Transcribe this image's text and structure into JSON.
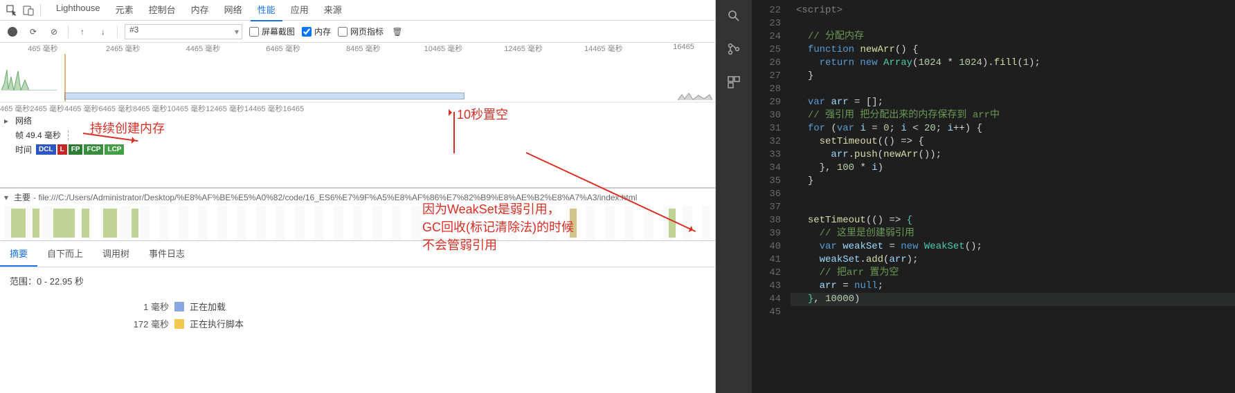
{
  "devtools": {
    "header_tabs": [
      "Lighthouse",
      "元素",
      "控制台",
      "内存",
      "网络",
      "性能",
      "应用",
      "来源"
    ],
    "active_header_tab": 5,
    "toolbar": {
      "session_select": "#3",
      "chk_screenshot": "屏幕截图",
      "chk_memory": "内存",
      "chk_webvitals": "网页指标"
    },
    "ruler_ticks": [
      "465 毫秒",
      "2465 毫秒",
      "4465 毫秒",
      "6465 毫秒",
      "8465 毫秒",
      "10465 毫秒",
      "12465 毫秒",
      "14465 毫秒",
      "16465"
    ],
    "rows": {
      "network": "网络",
      "frame": "帧 49.4 毫秒",
      "time": "时间"
    },
    "badges": [
      "DCL",
      "L",
      "FP",
      "FCP",
      "LCP"
    ],
    "main_label": "主要",
    "main_path": "- file:///C:/Users/Administrator/Desktop/%E8%AF%BE%E5%A0%82/code/16_ES6%E7%9F%A5%E8%AF%86%E7%82%B9%E8%AE%B2%E8%A7%A3/index.html",
    "bottom_tabs": [
      "摘要",
      "自下而上",
      "调用树",
      "事件日志"
    ],
    "summary_range": "范围：0 - 22.95 秒",
    "legend": [
      {
        "dur": "1 毫秒",
        "label": "正在加载",
        "class": "sw-load"
      },
      {
        "dur": "172 毫秒",
        "label": "正在执行脚本",
        "class": "sw-script"
      }
    ]
  },
  "annotations": {
    "a1": "持续创建内存",
    "a2": "10秒置空",
    "a3_l1": "因为WeakSet是弱引用，",
    "a3_l2": "GC回收(标记清除法)的时候",
    "a3_l3": "不会管弱引用"
  },
  "editor": {
    "first_line": 22,
    "highlight_line": 44,
    "lines": [
      {
        "n": 22,
        "seg": [
          {
            "c": "t-tag",
            "t": "<script>"
          }
        ]
      },
      {
        "n": 23,
        "seg": [
          {
            "c": "",
            "t": ""
          }
        ]
      },
      {
        "n": 24,
        "seg": [
          {
            "c": "",
            "t": "  "
          },
          {
            "c": "t-cm",
            "t": "// 分配内存"
          }
        ]
      },
      {
        "n": 25,
        "seg": [
          {
            "c": "",
            "t": "  "
          },
          {
            "c": "t-kw",
            "t": "function"
          },
          {
            "c": "",
            "t": " "
          },
          {
            "c": "t-fn",
            "t": "newArr"
          },
          {
            "c": "t-op",
            "t": "() {"
          }
        ]
      },
      {
        "n": 26,
        "seg": [
          {
            "c": "",
            "t": "    "
          },
          {
            "c": "t-kw",
            "t": "return new"
          },
          {
            "c": "",
            "t": " "
          },
          {
            "c": "t-type",
            "t": "Array"
          },
          {
            "c": "t-op",
            "t": "("
          },
          {
            "c": "t-num",
            "t": "1024"
          },
          {
            "c": "t-op",
            "t": " * "
          },
          {
            "c": "t-num",
            "t": "1024"
          },
          {
            "c": "t-op",
            "t": ")."
          },
          {
            "c": "t-fn",
            "t": "fill"
          },
          {
            "c": "t-op",
            "t": "("
          },
          {
            "c": "t-num",
            "t": "1"
          },
          {
            "c": "t-op",
            "t": ");"
          }
        ]
      },
      {
        "n": 27,
        "seg": [
          {
            "c": "",
            "t": "  "
          },
          {
            "c": "t-op",
            "t": "}"
          }
        ]
      },
      {
        "n": 28,
        "seg": [
          {
            "c": "",
            "t": ""
          }
        ]
      },
      {
        "n": 29,
        "seg": [
          {
            "c": "",
            "t": "  "
          },
          {
            "c": "t-kw",
            "t": "var"
          },
          {
            "c": "",
            "t": " "
          },
          {
            "c": "t-var",
            "t": "arr"
          },
          {
            "c": "t-op",
            "t": " = [];"
          }
        ]
      },
      {
        "n": 30,
        "seg": [
          {
            "c": "",
            "t": "  "
          },
          {
            "c": "t-cm",
            "t": "// 强引用 把分配出来的内存保存到 arr中"
          }
        ]
      },
      {
        "n": 31,
        "seg": [
          {
            "c": "",
            "t": "  "
          },
          {
            "c": "t-kw",
            "t": "for"
          },
          {
            "c": "t-op",
            "t": " ("
          },
          {
            "c": "t-kw",
            "t": "var"
          },
          {
            "c": "",
            "t": " "
          },
          {
            "c": "t-var",
            "t": "i"
          },
          {
            "c": "t-op",
            "t": " = "
          },
          {
            "c": "t-num",
            "t": "0"
          },
          {
            "c": "t-op",
            "t": "; "
          },
          {
            "c": "t-var",
            "t": "i"
          },
          {
            "c": "t-op",
            "t": " < "
          },
          {
            "c": "t-num",
            "t": "20"
          },
          {
            "c": "t-op",
            "t": "; "
          },
          {
            "c": "t-var",
            "t": "i"
          },
          {
            "c": "t-op",
            "t": "++) {"
          }
        ]
      },
      {
        "n": 32,
        "seg": [
          {
            "c": "",
            "t": "    "
          },
          {
            "c": "t-fn",
            "t": "setTimeout"
          },
          {
            "c": "t-op",
            "t": "(() => {"
          }
        ]
      },
      {
        "n": 33,
        "seg": [
          {
            "c": "",
            "t": "      "
          },
          {
            "c": "t-var",
            "t": "arr"
          },
          {
            "c": "t-op",
            "t": "."
          },
          {
            "c": "t-fn",
            "t": "push"
          },
          {
            "c": "t-op",
            "t": "("
          },
          {
            "c": "t-fn",
            "t": "newArr"
          },
          {
            "c": "t-op",
            "t": "());"
          }
        ]
      },
      {
        "n": 34,
        "seg": [
          {
            "c": "",
            "t": "    "
          },
          {
            "c": "t-op",
            "t": "}, "
          },
          {
            "c": "t-num",
            "t": "100"
          },
          {
            "c": "t-op",
            "t": " * "
          },
          {
            "c": "t-var",
            "t": "i"
          },
          {
            "c": "t-op",
            "t": ")"
          }
        ]
      },
      {
        "n": 35,
        "seg": [
          {
            "c": "",
            "t": "  "
          },
          {
            "c": "t-op",
            "t": "}"
          }
        ]
      },
      {
        "n": 36,
        "seg": [
          {
            "c": "",
            "t": ""
          }
        ]
      },
      {
        "n": 37,
        "seg": [
          {
            "c": "",
            "t": ""
          }
        ]
      },
      {
        "n": 38,
        "seg": [
          {
            "c": "",
            "t": "  "
          },
          {
            "c": "t-fn",
            "t": "setTimeout"
          },
          {
            "c": "t-op",
            "t": "(() => "
          },
          {
            "c": "t-type",
            "t": "{"
          }
        ]
      },
      {
        "n": 39,
        "seg": [
          {
            "c": "",
            "t": "    "
          },
          {
            "c": "t-cm",
            "t": "// 这里是创建弱引用"
          }
        ]
      },
      {
        "n": 40,
        "seg": [
          {
            "c": "",
            "t": "    "
          },
          {
            "c": "t-kw",
            "t": "var"
          },
          {
            "c": "",
            "t": " "
          },
          {
            "c": "t-var",
            "t": "weakSet"
          },
          {
            "c": "t-op",
            "t": " = "
          },
          {
            "c": "t-kw",
            "t": "new"
          },
          {
            "c": "",
            "t": " "
          },
          {
            "c": "t-type",
            "t": "WeakSet"
          },
          {
            "c": "t-op",
            "t": "();"
          }
        ]
      },
      {
        "n": 41,
        "seg": [
          {
            "c": "",
            "t": "    "
          },
          {
            "c": "t-var",
            "t": "weakSet"
          },
          {
            "c": "t-op",
            "t": "."
          },
          {
            "c": "t-fn",
            "t": "add"
          },
          {
            "c": "t-op",
            "t": "("
          },
          {
            "c": "t-var",
            "t": "arr"
          },
          {
            "c": "t-op",
            "t": ");"
          }
        ]
      },
      {
        "n": 42,
        "seg": [
          {
            "c": "",
            "t": "    "
          },
          {
            "c": "t-cm",
            "t": "// 把arr 置为空"
          }
        ]
      },
      {
        "n": 43,
        "seg": [
          {
            "c": "",
            "t": "    "
          },
          {
            "c": "t-var",
            "t": "arr"
          },
          {
            "c": "t-op",
            "t": " = "
          },
          {
            "c": "t-kw",
            "t": "null"
          },
          {
            "c": "t-op",
            "t": ";"
          }
        ]
      },
      {
        "n": 44,
        "seg": [
          {
            "c": "",
            "t": "  "
          },
          {
            "c": "t-type",
            "t": "}"
          },
          {
            "c": "t-op",
            "t": ", "
          },
          {
            "c": "t-num",
            "t": "10000"
          },
          {
            "c": "t-op",
            "t": ")"
          }
        ]
      },
      {
        "n": 45,
        "seg": [
          {
            "c": "",
            "t": ""
          }
        ]
      }
    ]
  }
}
